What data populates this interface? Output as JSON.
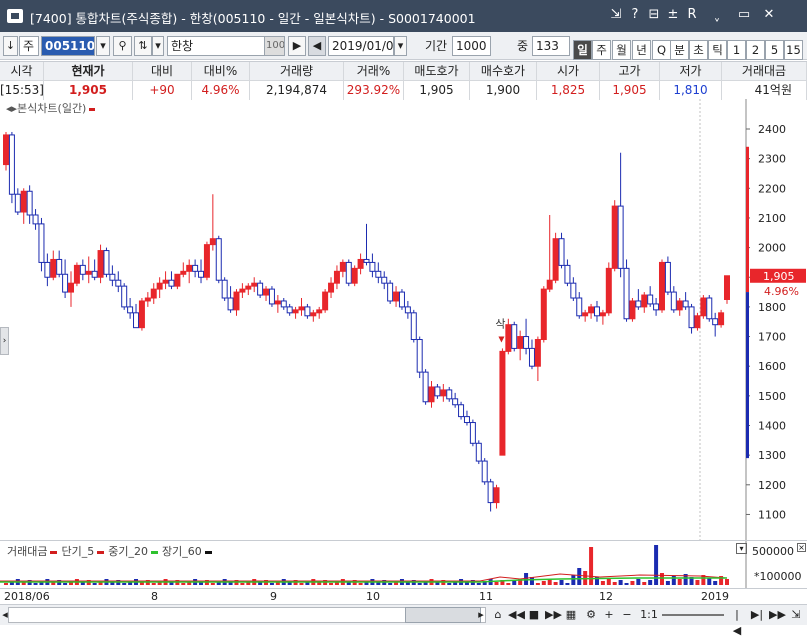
{
  "window": {
    "title": "[7400] 통합차트(주식종합) - 한창(005110 - 일간 - 일본식차트) - S0001740001",
    "controls": [
      "⇲",
      "?",
      "⊟",
      "±",
      "R",
      "ˬ",
      "▭",
      "✕"
    ]
  },
  "toolbar": {
    "market_label": "주",
    "code_value": "005110",
    "name_value": "한창",
    "name_badge": "100",
    "date_value": "2019/01/08",
    "period_label": "기간",
    "period_value": "1000",
    "count_label": "중",
    "count_value": "133",
    "periods": [
      "일",
      "주",
      "월",
      "년",
      "Q",
      "분",
      "초",
      "틱",
      "1",
      "2",
      "5",
      "15"
    ],
    "active_period": "일"
  },
  "quote": {
    "headers": [
      "시각",
      "현재가",
      "대비",
      "대비%",
      "거래량",
      "거래%",
      "매도호가",
      "매수호가",
      "시가",
      "고가",
      "저가",
      "거래대금"
    ],
    "values": [
      "[15:53]",
      "1,905",
      "+90",
      "4.96%",
      "2,194,874",
      "293.92%",
      "1,905",
      "1,900",
      "1,825",
      "1,905",
      "1,810",
      "41억원"
    ]
  },
  "chart_legend": "본식차트(일간)",
  "price_badge": {
    "price": "1,905",
    "pct": "4.96%"
  },
  "volume_legend": {
    "label": "거래대금",
    "items": [
      {
        "name": "단기_5",
        "color": "#d21e1e"
      },
      {
        "name": "중기_20",
        "color": "#d21e1e"
      },
      {
        "name": "장기_60",
        "color": "#2ec22e"
      }
    ],
    "scale": [
      "500000",
      "*100000"
    ]
  },
  "annotation": "삭",
  "chart_data": {
    "type": "candlestick",
    "y_ticks": [
      2400,
      2300,
      2200,
      2100,
      2000,
      1900,
      1800,
      1700,
      1600,
      1500,
      1400,
      1300,
      1200,
      1100
    ],
    "ylim": [
      1050,
      2450
    ],
    "x_labels": [
      "2018/06",
      "8",
      "9",
      "10",
      "11",
      "12",
      "2019"
    ],
    "colors": {
      "up": "#e8262b",
      "down": "#1b2bb0"
    },
    "candles": [
      [
        2280,
        2390,
        2260,
        2380
      ],
      [
        2380,
        2390,
        2150,
        2180
      ],
      [
        2180,
        2200,
        2110,
        2120
      ],
      [
        2120,
        2200,
        2080,
        2190
      ],
      [
        2190,
        2210,
        2080,
        2110
      ],
      [
        2110,
        2130,
        2060,
        2080
      ],
      [
        2080,
        2100,
        1920,
        1950
      ],
      [
        1950,
        1980,
        1870,
        1900
      ],
      [
        1900,
        1990,
        1890,
        1960
      ],
      [
        1960,
        1990,
        1900,
        1910
      ],
      [
        1910,
        1960,
        1830,
        1850
      ],
      [
        1850,
        1920,
        1800,
        1880
      ],
      [
        1880,
        1950,
        1870,
        1940
      ],
      [
        1940,
        1960,
        1890,
        1910
      ],
      [
        1910,
        1970,
        1880,
        1920
      ],
      [
        1920,
        1960,
        1890,
        1900
      ],
      [
        1900,
        2010,
        1880,
        1990
      ],
      [
        1990,
        2000,
        1900,
        1910
      ],
      [
        1910,
        1940,
        1870,
        1890
      ],
      [
        1890,
        1920,
        1850,
        1870
      ],
      [
        1870,
        1880,
        1790,
        1800
      ],
      [
        1800,
        1830,
        1760,
        1780
      ],
      [
        1780,
        1810,
        1730,
        1730
      ],
      [
        1730,
        1830,
        1720,
        1820
      ],
      [
        1820,
        1850,
        1800,
        1830
      ],
      [
        1830,
        1880,
        1810,
        1860
      ],
      [
        1860,
        1900,
        1830,
        1880
      ],
      [
        1880,
        1920,
        1860,
        1890
      ],
      [
        1890,
        1920,
        1860,
        1870
      ],
      [
        1870,
        1910,
        1860,
        1910
      ],
      [
        1910,
        1950,
        1900,
        1920
      ],
      [
        1920,
        1960,
        1880,
        1940
      ],
      [
        1940,
        1960,
        1900,
        1920
      ],
      [
        1920,
        1960,
        1880,
        1900
      ],
      [
        1900,
        2020,
        1890,
        2010
      ],
      [
        2010,
        2180,
        1990,
        2030
      ],
      [
        2030,
        2040,
        1880,
        1890
      ],
      [
        1890,
        1900,
        1820,
        1830
      ],
      [
        1830,
        1870,
        1780,
        1790
      ],
      [
        1790,
        1860,
        1770,
        1850
      ],
      [
        1850,
        1880,
        1830,
        1860
      ],
      [
        1860,
        1880,
        1840,
        1870
      ],
      [
        1870,
        1900,
        1850,
        1880
      ],
      [
        1880,
        1890,
        1830,
        1840
      ],
      [
        1840,
        1870,
        1820,
        1860
      ],
      [
        1860,
        1870,
        1800,
        1810
      ],
      [
        1810,
        1840,
        1780,
        1820
      ],
      [
        1820,
        1830,
        1790,
        1800
      ],
      [
        1800,
        1810,
        1770,
        1780
      ],
      [
        1780,
        1800,
        1760,
        1790
      ],
      [
        1790,
        1830,
        1770,
        1800
      ],
      [
        1800,
        1810,
        1760,
        1770
      ],
      [
        1770,
        1790,
        1750,
        1780
      ],
      [
        1780,
        1800,
        1760,
        1790
      ],
      [
        1790,
        1860,
        1780,
        1850
      ],
      [
        1850,
        1900,
        1830,
        1880
      ],
      [
        1880,
        1940,
        1860,
        1920
      ],
      [
        1920,
        1960,
        1900,
        1950
      ],
      [
        1950,
        1960,
        1870,
        1880
      ],
      [
        1880,
        1940,
        1870,
        1930
      ],
      [
        1930,
        1980,
        1910,
        1960
      ],
      [
        1960,
        2080,
        1940,
        1950
      ],
      [
        1950,
        1980,
        1900,
        1920
      ],
      [
        1920,
        1950,
        1880,
        1900
      ],
      [
        1900,
        1920,
        1860,
        1880
      ],
      [
        1880,
        1890,
        1810,
        1820
      ],
      [
        1820,
        1870,
        1800,
        1850
      ],
      [
        1850,
        1860,
        1790,
        1800
      ],
      [
        1800,
        1820,
        1760,
        1780
      ],
      [
        1780,
        1790,
        1680,
        1690
      ],
      [
        1690,
        1700,
        1560,
        1580
      ],
      [
        1580,
        1590,
        1470,
        1480
      ],
      [
        1480,
        1550,
        1460,
        1530
      ],
      [
        1530,
        1540,
        1490,
        1500
      ],
      [
        1500,
        1540,
        1480,
        1520
      ],
      [
        1520,
        1530,
        1480,
        1490
      ],
      [
        1490,
        1510,
        1460,
        1470
      ],
      [
        1470,
        1480,
        1420,
        1430
      ],
      [
        1430,
        1450,
        1400,
        1410
      ],
      [
        1410,
        1420,
        1330,
        1340
      ],
      [
        1340,
        1350,
        1270,
        1280
      ],
      [
        1280,
        1290,
        1200,
        1210
      ],
      [
        1210,
        1220,
        1110,
        1140
      ],
      [
        1140,
        1200,
        1120,
        1190
      ],
      [
        1300,
        1660,
        1300,
        1650
      ],
      [
        1650,
        1760,
        1640,
        1740
      ],
      [
        1740,
        1750,
        1650,
        1660
      ],
      [
        1660,
        1720,
        1620,
        1700
      ],
      [
        1700,
        1760,
        1640,
        1660
      ],
      [
        1660,
        1690,
        1590,
        1600
      ],
      [
        1600,
        1700,
        1550,
        1690
      ],
      [
        1690,
        1870,
        1680,
        1860
      ],
      [
        1860,
        2110,
        1850,
        1890
      ],
      [
        1890,
        2050,
        1880,
        2030
      ],
      [
        2030,
        2050,
        1930,
        1940
      ],
      [
        1940,
        1960,
        1870,
        1880
      ],
      [
        1880,
        1900,
        1820,
        1830
      ],
      [
        1830,
        1850,
        1760,
        1770
      ],
      [
        1770,
        1790,
        1750,
        1780
      ],
      [
        1780,
        1810,
        1760,
        1800
      ],
      [
        1800,
        1820,
        1750,
        1770
      ],
      [
        1770,
        1790,
        1740,
        1780
      ],
      [
        1780,
        1950,
        1770,
        1930
      ],
      [
        1930,
        2160,
        1920,
        2140
      ],
      [
        2140,
        2320,
        1900,
        1930
      ],
      [
        1930,
        1960,
        1750,
        1760
      ],
      [
        1760,
        1830,
        1750,
        1820
      ],
      [
        1820,
        1860,
        1790,
        1800
      ],
      [
        1800,
        1850,
        1780,
        1840
      ],
      [
        1840,
        1870,
        1800,
        1810
      ],
      [
        1810,
        1830,
        1770,
        1790
      ],
      [
        1790,
        1960,
        1780,
        1950
      ],
      [
        1950,
        1970,
        1840,
        1850
      ],
      [
        1850,
        1870,
        1780,
        1790
      ],
      [
        1790,
        1830,
        1770,
        1820
      ],
      [
        1820,
        1850,
        1790,
        1800
      ],
      [
        1800,
        1810,
        1710,
        1730
      ],
      [
        1730,
        1780,
        1720,
        1770
      ],
      [
        1770,
        1840,
        1760,
        1830
      ],
      [
        1830,
        1840,
        1750,
        1760
      ],
      [
        1760,
        1780,
        1700,
        1740
      ],
      [
        1740,
        1790,
        1730,
        1780
      ],
      [
        1825,
        1905,
        1810,
        1905
      ]
    ]
  }
}
